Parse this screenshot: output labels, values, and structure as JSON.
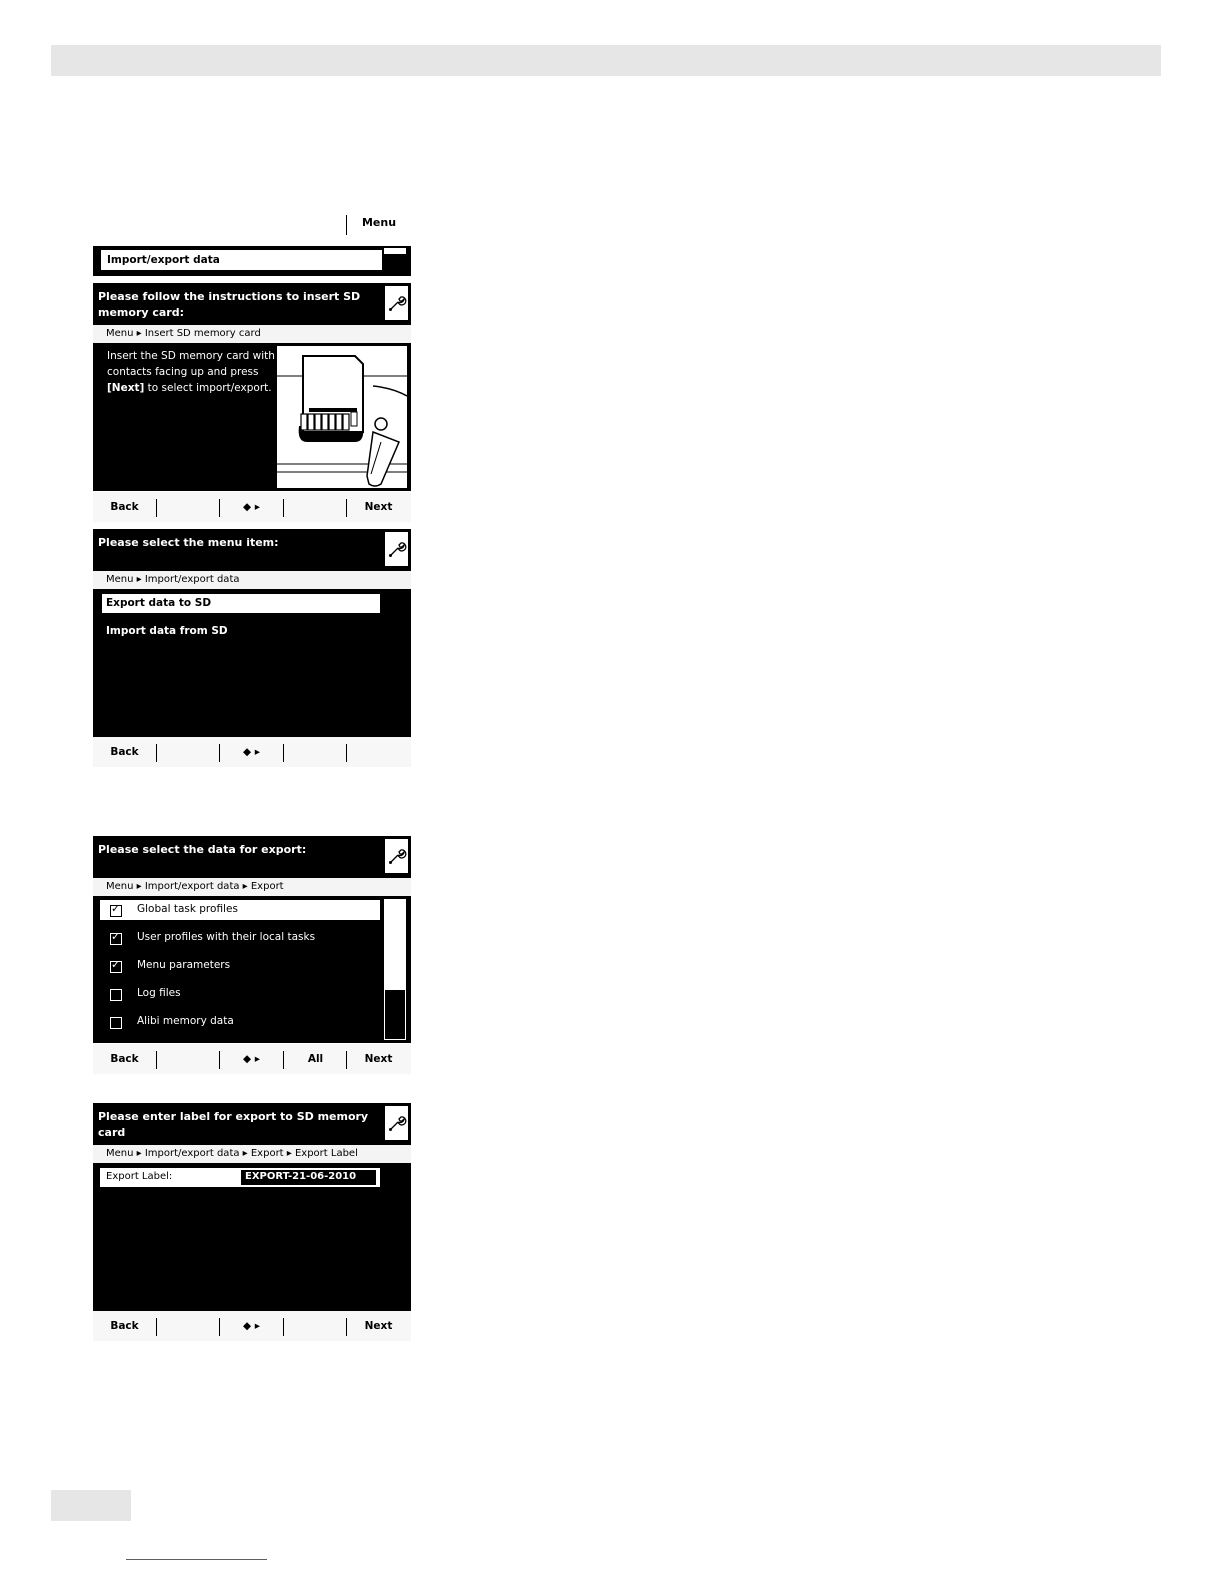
{
  "top_bar": {
    "menu_label": "Menu"
  },
  "screen1": {
    "title": "Import/export data"
  },
  "screen2": {
    "heading": "Please follow the instructions to insert SD memory card:",
    "breadcrumb": "Menu ▸ Insert SD memory card",
    "instr_line1": "Insert the SD memory card with",
    "instr_line2": "contacts facing up and press",
    "instr_next": "[Next]",
    "instr_line3_rest": " to select import/export.",
    "softkeys": {
      "back": "Back",
      "nav": "◆ ▸",
      "next": "Next"
    }
  },
  "screen3": {
    "heading": "Please select the menu item:",
    "breadcrumb": "Menu ▸ Import/export data",
    "items": [
      "Export data to SD",
      "Import data from SD"
    ],
    "softkeys": {
      "back": "Back",
      "nav": "◆ ▸"
    }
  },
  "screen4": {
    "heading": "Please select the data for export:",
    "breadcrumb": "Menu ▸ Import/export data ▸ Export",
    "options": [
      {
        "label": "Global task profiles",
        "mark": "✓"
      },
      {
        "label": "User profiles with their local tasks",
        "mark": "✓"
      },
      {
        "label": "Menu parameters",
        "mark": "✓"
      },
      {
        "label": "Log files",
        "mark": ""
      },
      {
        "label": "Alibi memory data",
        "mark": ""
      }
    ],
    "scroll_position": 0.65,
    "softkeys": {
      "back": "Back",
      "nav": "◆ ▸",
      "all": "All",
      "next": "Next"
    }
  },
  "screen5": {
    "heading": "Please enter label for export to SD memory card",
    "breadcrumb": "Menu ▸ Import/export data ▸ Export ▸ Export Label",
    "field_label": "Export Label:",
    "field_value": "EXPORT-21-06-2010",
    "softkeys": {
      "back": "Back",
      "nav": "◆ ▸",
      "next": "Next"
    }
  }
}
